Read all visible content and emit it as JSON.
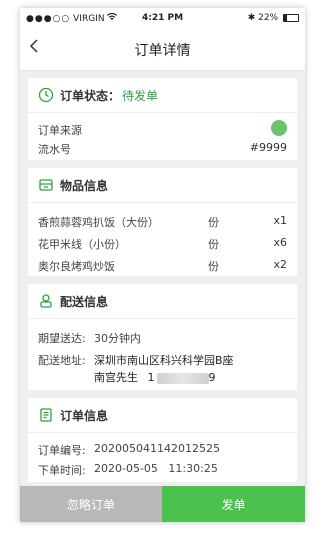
{
  "statusbar": {
    "carrier": "VIRGIN",
    "time": "4:21 PM",
    "battery": "22%"
  },
  "nav": {
    "title": "订单详情"
  },
  "order_status": {
    "label": "订单状态：",
    "value": "待发单",
    "source_label": "订单来源",
    "serial_label": "流水号",
    "serial_value": "#9999"
  },
  "items_section": {
    "title": "物品信息",
    "items": [
      {
        "name": "香煎蒜蓉鸡扒饭（大份）",
        "unit": "份",
        "qty": "x1"
      },
      {
        "name": "花甲米线（小份）",
        "unit": "份",
        "qty": "x6"
      },
      {
        "name": "奥尔良烤鸡炒饭",
        "unit": "份",
        "qty": "x2"
      }
    ]
  },
  "delivery": {
    "title": "配送信息",
    "expected_label": "期望送达:",
    "expected_value": "30分钟内",
    "address_label": "配送地址:",
    "address_value": "深圳市南山区科兴科学园B座",
    "contact_name": "南宫先生",
    "phone_prefix": "1",
    "phone_suffix": "9"
  },
  "order_info": {
    "title": "订单信息",
    "number_label": "订单编号:",
    "number_value": "202005041142012525",
    "time_label": "下单时间:",
    "time_value": "2020-05-05   11:30:25"
  },
  "actions": {
    "ignore": "忽略订单",
    "ship": "发单"
  },
  "colors": {
    "accent_green": "#4ac24e",
    "status_green": "#2aa33a",
    "ignore_gray": "#b8b8b8"
  }
}
